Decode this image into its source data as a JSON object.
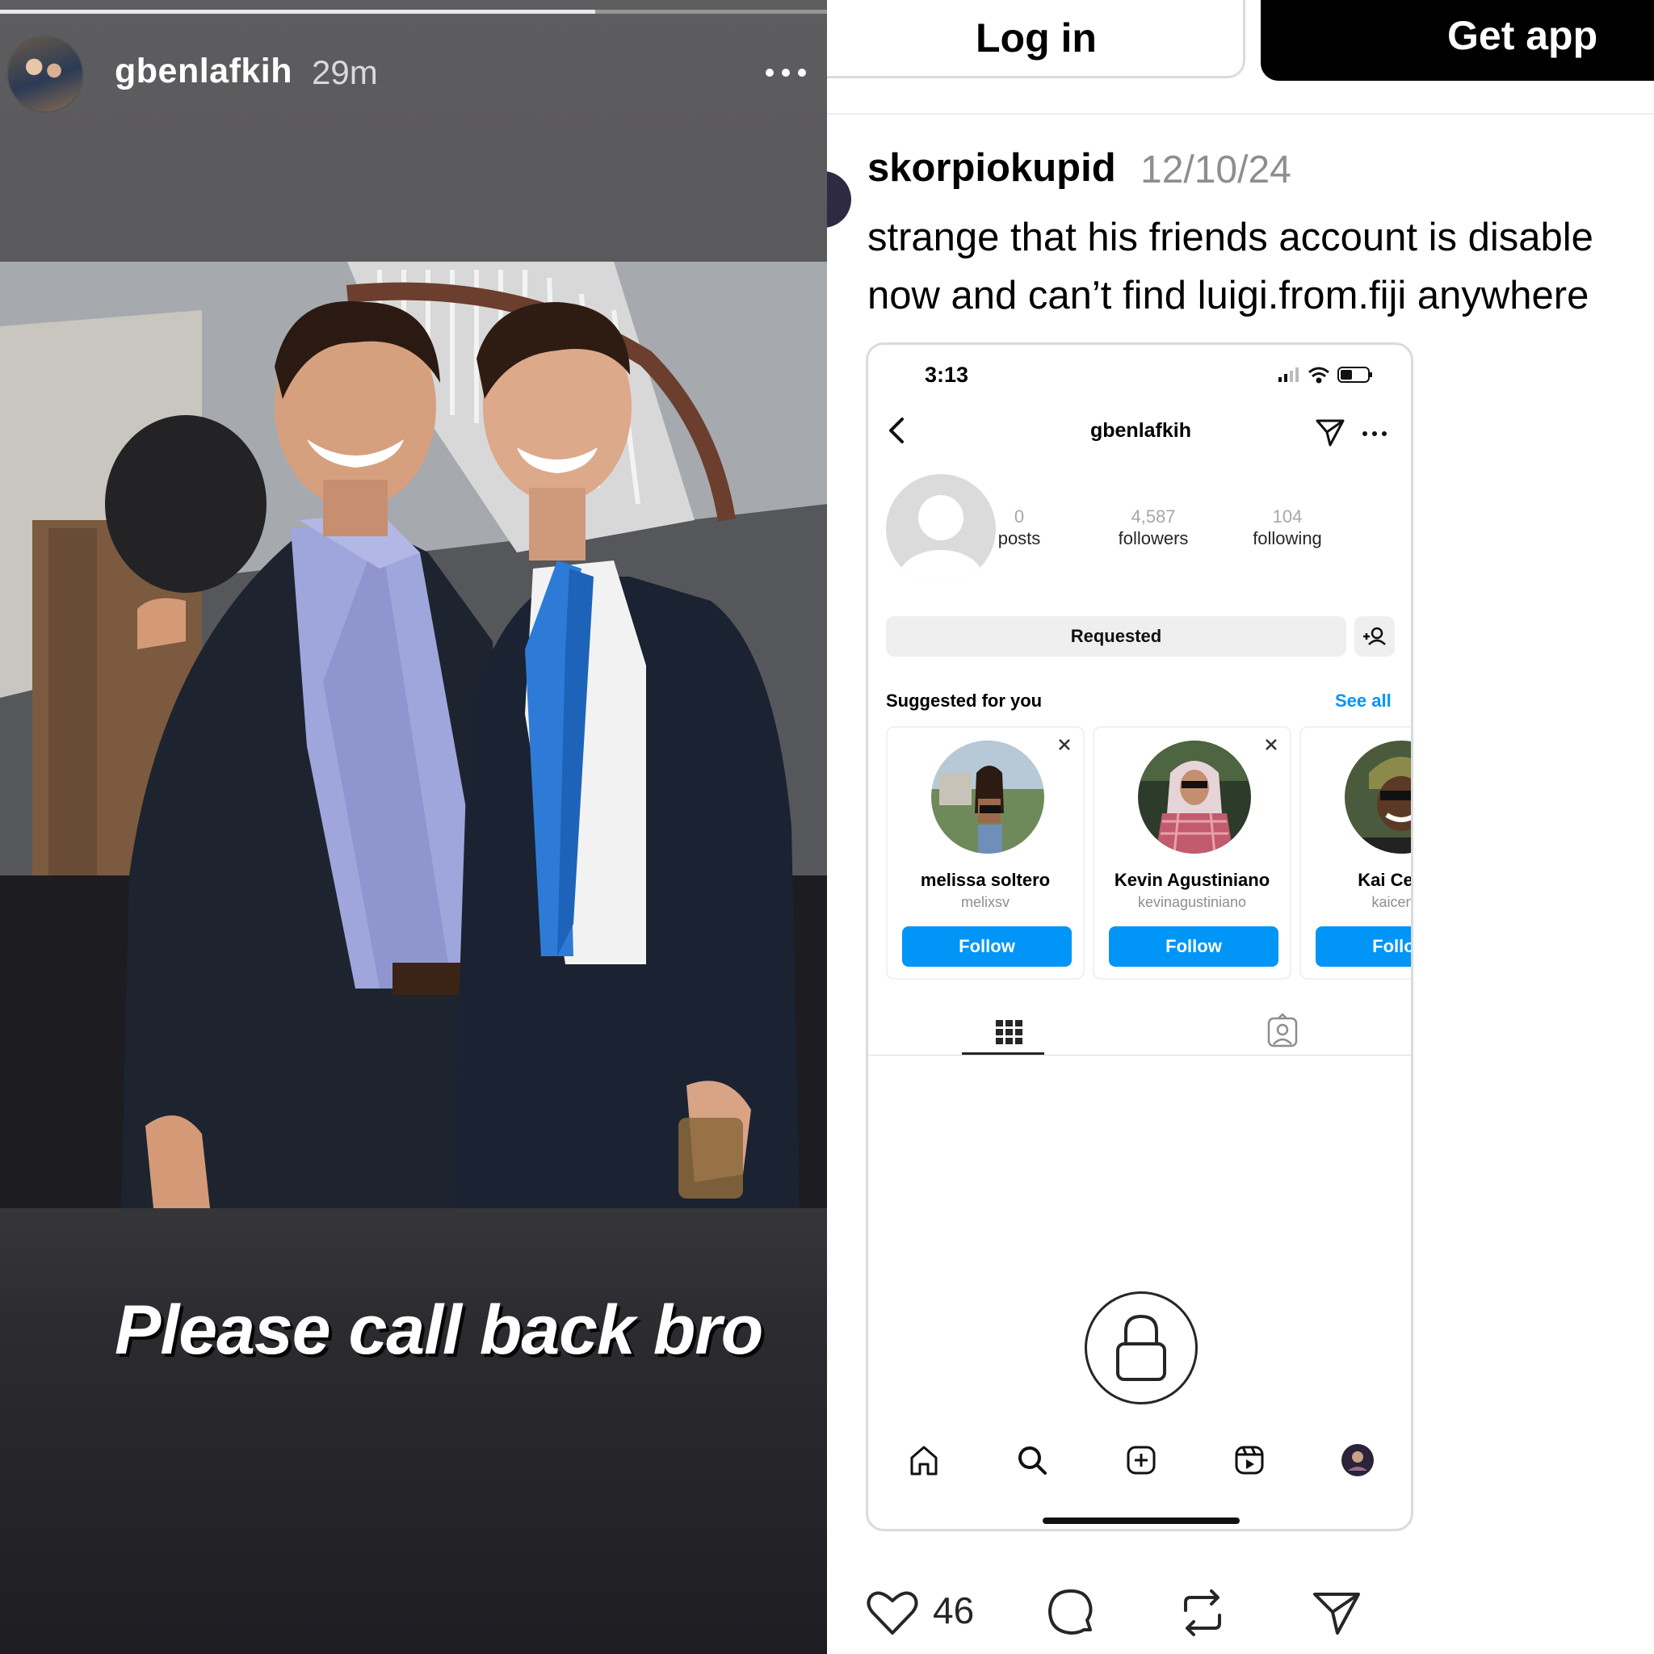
{
  "story": {
    "username": "gbenlafkih",
    "time": "29m",
    "progress": 0.72,
    "caption": "Please call back bro"
  },
  "post": {
    "login_label": "Log in",
    "get_app_label": "Get app",
    "username": "skorpiokupid",
    "date": "12/10/24",
    "text": "strange that his friends account is disable\nnow and can’t find luigi.from.fiji anywhere",
    "like_count": "46",
    "icons": [
      "heart-icon",
      "comment-icon",
      "repost-icon",
      "share-icon"
    ]
  },
  "screenshot": {
    "status_time": "3:13",
    "profile_username": "gbenlafkih",
    "stats": [
      {
        "count": "0",
        "label": "posts"
      },
      {
        "count": "4,587",
        "label": "followers"
      },
      {
        "count": "104",
        "label": "following"
      }
    ],
    "requested_label": "Requested",
    "suggested_title": "Suggested for you",
    "see_all_label": "See all",
    "suggestions": [
      {
        "name": "melissa soltero",
        "handle": "melixsv",
        "follow_label": "Follow"
      },
      {
        "name": "Kevin Agustiniano",
        "handle": "kevinagustiniano",
        "follow_label": "Follow"
      },
      {
        "name": "Kai Cenat",
        "handle": "kaicenat",
        "follow_label": "Follow"
      }
    ],
    "nav_icons": [
      "home-icon",
      "search-icon",
      "create-icon",
      "reels-icon",
      "profile-icon"
    ]
  },
  "colors": {
    "follow_blue": "#0095f6",
    "requested_bg": "#efefef",
    "story_bg": "#5a595c"
  }
}
